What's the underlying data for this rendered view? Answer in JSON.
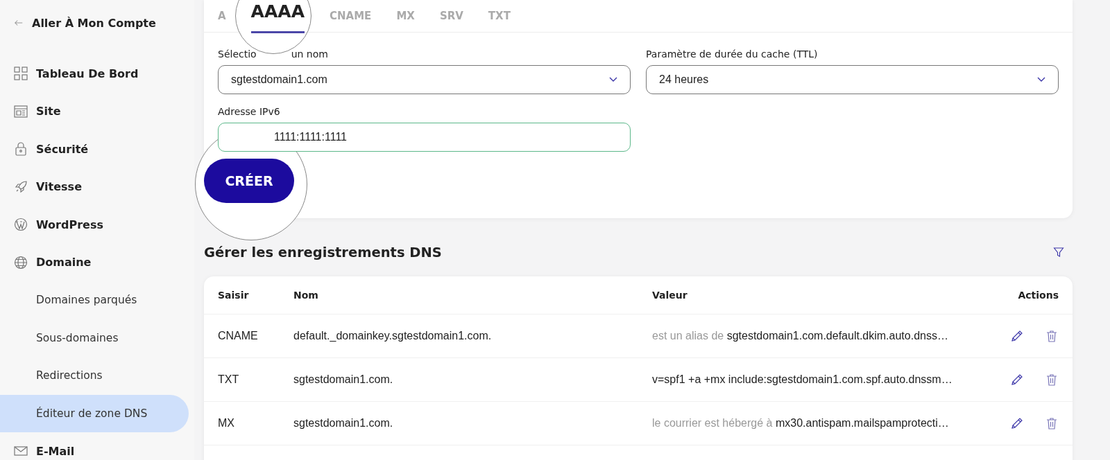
{
  "sidebar": {
    "back_link": "Aller À Mon Compte",
    "items": [
      {
        "label": "Tableau De Bord",
        "selected": false
      },
      {
        "label": "Site",
        "selected": false
      },
      {
        "label": "Sécurité",
        "selected": false
      },
      {
        "label": "Vitesse",
        "selected": false
      },
      {
        "label": "WordPress",
        "selected": false
      },
      {
        "label": "Domaine",
        "selected": false,
        "children": [
          {
            "label": "Domaines parqués",
            "selected": false
          },
          {
            "label": "Sous-domaines",
            "selected": false
          },
          {
            "label": "Redirections",
            "selected": false
          },
          {
            "label": "Éditeur de zone DNS",
            "selected": true
          }
        ]
      },
      {
        "label": "E-Mail",
        "selected": false
      }
    ]
  },
  "record_form": {
    "tabs": [
      {
        "label": "A",
        "selected": false
      },
      {
        "label": "AAAA",
        "selected": true
      },
      {
        "label": "CNAME",
        "selected": false
      },
      {
        "label": "MX",
        "selected": false
      },
      {
        "label": "SRV",
        "selected": false
      },
      {
        "label": "TXT",
        "selected": false
      }
    ],
    "name_field": {
      "label_parts": [
        "Sélectio",
        "un nom"
      ],
      "value": "sgtestdomain1.com"
    },
    "ttl_field": {
      "label": "Paramètre de durée du cache (TTL)",
      "value": "24 heures"
    },
    "ipv6_field": {
      "label": "Adresse IPv6",
      "value": "1111:1111:1111"
    },
    "create_button": "CRÉER"
  },
  "records": {
    "title": "Gérer les enregistrements DNS",
    "columns": [
      "Saisir",
      "Nom",
      "Valeur",
      "Actions"
    ],
    "rows": [
      {
        "type": "CNAME",
        "name": "default._domainkey.sgtestdomain1.com.",
        "value_prefix": "est un alias de",
        "value": "sgtestdomain1.com.default.dkim.auto.dnss…"
      },
      {
        "type": "TXT",
        "name": "sgtestdomain1.com.",
        "value": "v=spf1 +a +mx include:sgtestdomain1.com.spf.auto.dnssm…"
      },
      {
        "type": "MX",
        "name": "sgtestdomain1.com.",
        "value_prefix": "le courrier est hébergé à",
        "value": "mx30.antispam.mailspamprotecti…"
      }
    ]
  }
}
